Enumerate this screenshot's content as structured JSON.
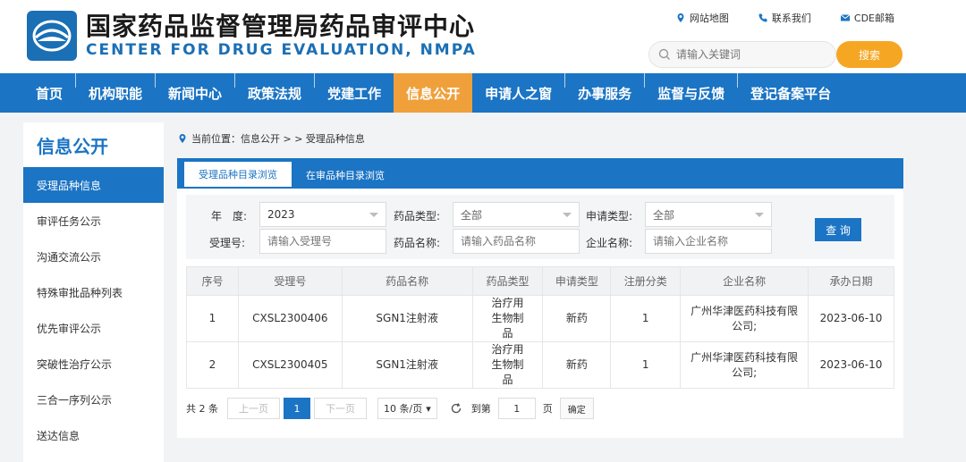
{
  "header": {
    "title_cn": "国家药品监督管理局药品审评中心",
    "title_en": "CENTER FOR DRUG EVALUATION, NMPA",
    "links": [
      "网站地图",
      "联系我们",
      "CDE邮箱"
    ],
    "search_placeholder": "请输入关键词",
    "search_button": "搜索"
  },
  "nav": {
    "items": [
      "首页",
      "机构职能",
      "新闻中心",
      "政策法规",
      "党建工作",
      "信息公开",
      "申请人之窗",
      "办事服务",
      "监督与反馈",
      "登记备案平台"
    ],
    "active": "信息公开"
  },
  "sidebar": {
    "title": "信息公开",
    "items": [
      "受理品种信息",
      "审评任务公示",
      "沟通交流公示",
      "特殊审批品种列表",
      "优先审评公示",
      "突破性治疗公示",
      "三合一序列公示",
      "送达信息"
    ]
  },
  "breadcrumb": "当前位置：信息公开 > > 受理品种信息",
  "tabs": [
    "受理品种目录浏览",
    "在审品种目录浏览"
  ],
  "filter": {
    "year_label": "年　度:",
    "year_value": "2023",
    "drug_type_label": "药品类型:",
    "drug_type_value": "全部",
    "apply_type_label": "申请类型:",
    "apply_type_value": "全部",
    "accept_no_label": "受理号:",
    "accept_no_placeholder": "请输入受理号",
    "drug_name_label": "药品名称:",
    "drug_name_placeholder": "请输入药品名称",
    "company_label": "企业名称:",
    "company_placeholder": "请输入企业名称",
    "query_button": "查 询"
  },
  "table": {
    "headers": [
      "序号",
      "受理号",
      "药品名称",
      "药品类型",
      "申请类型",
      "注册分类",
      "企业名称",
      "承办日期"
    ],
    "rows": [
      [
        "1",
        "CXSL2300406",
        "SGN1注射液",
        "治疗用生物制品",
        "新药",
        "1",
        "广州华津医药科技有限公司;",
        "2023-06-10"
      ],
      [
        "2",
        "CXSL2300405",
        "SGN1注射液",
        "治疗用生物制品",
        "新药",
        "1",
        "广州华津医药科技有限公司;",
        "2023-06-10"
      ]
    ]
  },
  "pager": {
    "total": "共 2 条",
    "prev": "上一页",
    "current": "1",
    "next": "下一页",
    "page_size": "10 条/页",
    "goto_label": "到第",
    "goto_value": "1",
    "page_unit": "页",
    "confirm": "确定"
  },
  "colors": {
    "primary": "#1b74c4",
    "accent": "#f0a03a",
    "search_button": "#f5a623"
  }
}
